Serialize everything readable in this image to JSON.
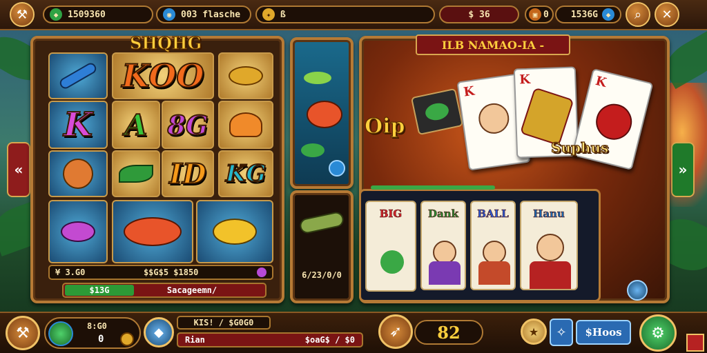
{
  "top_bar": {
    "gems_value": "1509360",
    "coins_value": "003 flasche",
    "level_label": "ß",
    "energy_value": "$ 36",
    "chest_value": "0",
    "bank_value": "1536G",
    "menu_icon": "crossed-tools-icon",
    "search_icon": "magnifier-icon",
    "close_icon": "close-x-icon"
  },
  "slot_panel": {
    "title": "SHQHG",
    "reel_symbols": [
      "KOO",
      "K",
      "A",
      "8G",
      "ID",
      "KG"
    ],
    "bet_info": "¥ 3.G0",
    "win_info": "$$G$5 $1850",
    "progress_label": "$13G",
    "status_label": "Sacageemn/"
  },
  "aquarium_panel": {
    "bottom_value": "6/23/0/0"
  },
  "card_panel": {
    "title": "ILB NAMAO-IA -",
    "flash_label": "Oip",
    "combo_label": "Suphus",
    "card_ranks": [
      "K",
      "K",
      "K"
    ],
    "mini_cards": [
      "BIG",
      "Dank",
      "BALL",
      "Hanu"
    ]
  },
  "bottom_bar": {
    "profile_value_top": "8:G0",
    "profile_value_bottom": "0",
    "info_line_top": "KIS! / $G0G0",
    "info_line_left": "Rian",
    "info_line_right": "$oaG$ / $0",
    "score_value": "82",
    "shop_label": "$Hoos"
  },
  "colors": {
    "wood": "#b67a35",
    "gold": "#ffcf3d",
    "panel_dark": "#3a200d",
    "accent_green": "#3aa845",
    "accent_red": "#b62222"
  }
}
